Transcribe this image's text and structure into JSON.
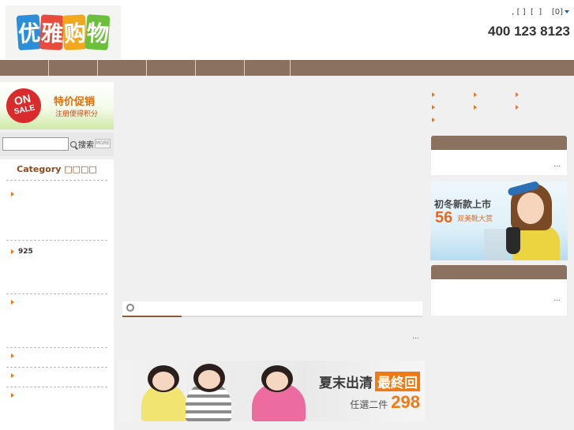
{
  "header": {
    "logo_text": [
      "优",
      "雅",
      "购",
      "物"
    ],
    "toplinks": ", [ ]  [  ]    [0]",
    "phone": "400 123 8123"
  },
  "nav": {
    "items": [
      "",
      "",
      "",
      "",
      "",
      ""
    ]
  },
  "left": {
    "onsale": {
      "badge_line1": "ON",
      "badge_line2": "SALE",
      "title": "特价促销",
      "subtitle": "注册便得积分"
    },
    "search": {
      "placeholder": "",
      "button_label": "搜索",
      "more_label": "MORE"
    },
    "category": {
      "title": "Category □□□□",
      "items": [
        "",
        "925",
        "",
        "",
        "",
        ""
      ]
    }
  },
  "center": {
    "more": "...",
    "banner": {
      "title": "夏末出清",
      "title_box": "最終回",
      "sub_text": "任選二件",
      "price": "298"
    }
  },
  "right": {
    "panel1_more": "...",
    "panel2_more": "...",
    "shoe_banner": {
      "title": "初冬新款上市",
      "number": "56",
      "subtitle": "双美靴大赏"
    }
  },
  "colors": {
    "nav": "#8b7260",
    "accent": "#e07a28",
    "category_title": "#8a4b1d"
  }
}
